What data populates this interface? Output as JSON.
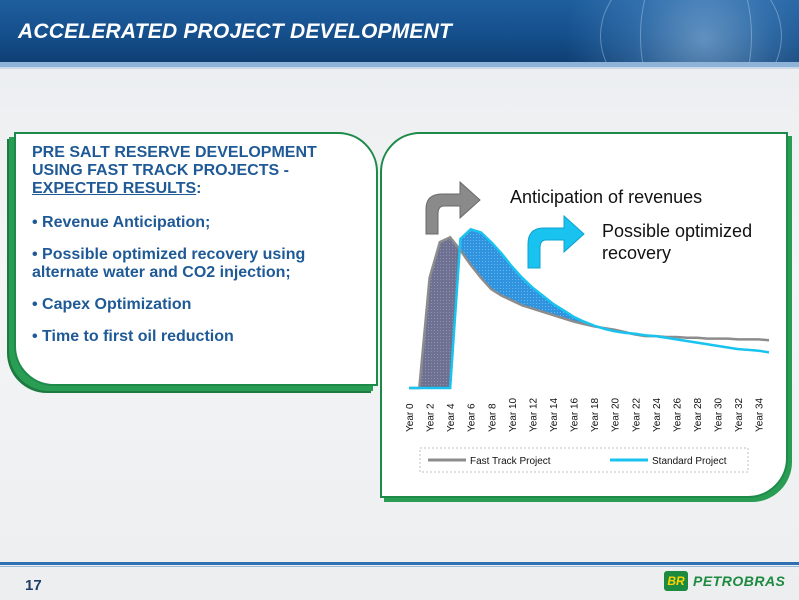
{
  "header": {
    "title": "ACCELERATED PROJECT DEVELOPMENT"
  },
  "panel": {
    "heading_line1": "PRE SALT RESERVE DEVELOPMENT",
    "heading_line2": "USING FAST TRACK PROJECTS -",
    "heading_line3": "EXPECTED RESULTS",
    "heading_colon": ":",
    "bullets": [
      "• Revenue Anticipation;",
      "• Possible optimized recovery using alternate water and CO2 injection;",
      "• Capex Optimization",
      "• Time to first oil reduction"
    ]
  },
  "footer": {
    "page_number": "17",
    "logo_mark": "BR",
    "logo_text": "PETROBRAS"
  },
  "colors": {
    "header_blue": "#1a5a9a",
    "panel_green": "#1e8a4a",
    "text_blue": "#1f5a96",
    "fast_track_line": "#8c8c8c",
    "fast_track_fill": "#6e7191",
    "standard_line": "#19c3f0",
    "standard_fill": "#2f93e0"
  },
  "chart_data": {
    "type": "area",
    "annotations": [
      "Anticipation of revenues",
      "Possible optimized recovery"
    ],
    "annotation_icons": [
      "gray-curved-arrow-icon",
      "cyan-curved-arrow-icon"
    ],
    "x_ticks": [
      "Year 0",
      "Year 2",
      "Year 4",
      "Year 6",
      "Year 8",
      "Year 10",
      "Year 12",
      "Year 14",
      "Year 16",
      "Year 18",
      "Year 20",
      "Year 22",
      "Year 24",
      "Year 26",
      "Year 28",
      "Year 30",
      "Year 32",
      "Year 34"
    ],
    "years": [
      0,
      1,
      2,
      3,
      4,
      5,
      6,
      7,
      8,
      9,
      10,
      11,
      12,
      13,
      14,
      15,
      16,
      17,
      18,
      19,
      20,
      21,
      22,
      23,
      24,
      25,
      26,
      27,
      28,
      29,
      30,
      31,
      32,
      33,
      34,
      35
    ],
    "ylim": [
      0,
      100
    ],
    "grid": false,
    "legend": "bottom",
    "series": [
      {
        "name": "Fast Track Project",
        "values": [
          0,
          0,
          68,
          90,
          93,
          85,
          76,
          68,
          61,
          57,
          54,
          51,
          49,
          47,
          45,
          43,
          41,
          39.5,
          38,
          37,
          36,
          34.5,
          33,
          32,
          32,
          31.5,
          31.5,
          31,
          31,
          30.5,
          30.5,
          30.5,
          30,
          30,
          30,
          29.5
        ]
      },
      {
        "name": "Standard Project",
        "values": [
          0,
          0,
          0,
          0,
          0,
          92,
          98,
          96,
          90,
          83,
          75,
          68,
          62,
          57,
          52,
          48,
          44,
          41,
          38.5,
          36.5,
          35,
          34,
          33.5,
          32.5,
          32,
          31,
          30,
          29,
          28,
          27,
          26,
          25,
          24,
          23.5,
          23,
          22
        ]
      }
    ]
  }
}
